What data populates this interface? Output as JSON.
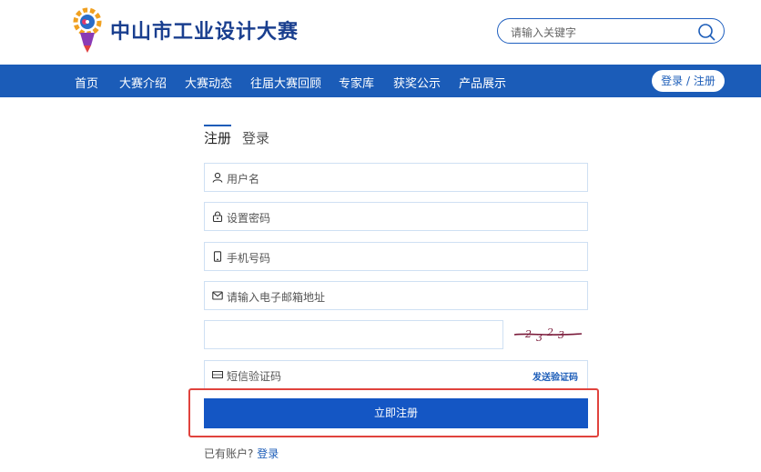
{
  "header": {
    "site_title": "中山市工业设计大赛",
    "search_placeholder": "请输入关键字"
  },
  "nav": {
    "items": [
      "首页",
      "大赛介绍",
      "大赛动态",
      "往届大赛回顾",
      "专家库",
      "获奖公示",
      "产品展示"
    ],
    "login_register": "登录 / 注册"
  },
  "form": {
    "tab_register": "注册",
    "tab_login": "登录",
    "username_placeholder": "用户名",
    "password_placeholder": "设置密码",
    "phone_placeholder": "手机号码",
    "email_placeholder": "请输入电子邮箱地址",
    "sms_placeholder": "短信验证码",
    "send_code": "发送验证码",
    "submit": "立即注册",
    "has_account": "已有账户?",
    "login_link": "登录"
  },
  "colors": {
    "primary": "#1b5cb8",
    "highlight": "#e0433d"
  }
}
